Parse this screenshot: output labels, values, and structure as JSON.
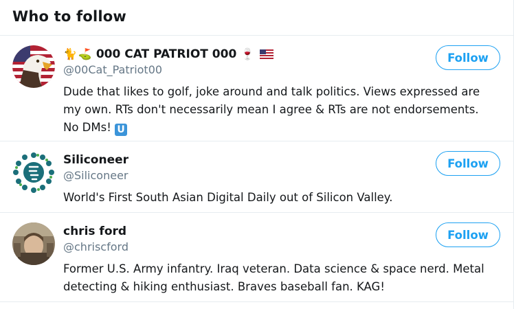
{
  "panel": {
    "title": "Who to follow"
  },
  "users": [
    {
      "emoji_prefix": [
        "🐈",
        "⛳"
      ],
      "name": "000 CAT PATRIOT 000",
      "emoji_suffix": [
        "🍷"
      ],
      "flag": "us-flag",
      "handle": "@00Cat_Patriot00",
      "bio": "Dude that likes to golf, joke around and talk politics. Views expressed are my own. RTs don't necessarily mean I agree & RTs are not endorsements. No DMs!",
      "bio_badge": "U",
      "follow_label": "Follow",
      "avatar": "eagle-avatar"
    },
    {
      "name": "Siliconeer",
      "handle": "@Siliconeer",
      "bio": "World's First South Asian Digital Daily out of Silicon Valley.",
      "follow_label": "Follow",
      "avatar": "siliconeer-logo-avatar"
    },
    {
      "name": "chris ford",
      "handle": "@chriscford",
      "bio": "Former U.S. Army infantry. Iraq veteran. Data science & space nerd. Metal detecting & hiking enthusiast. Braves baseball fan. KAG!",
      "follow_label": "Follow",
      "avatar": "photo-avatar"
    }
  ],
  "colors": {
    "accent": "#1da1f2",
    "muted": "#657786",
    "divider": "#e6ecf0",
    "text": "#14171a"
  }
}
